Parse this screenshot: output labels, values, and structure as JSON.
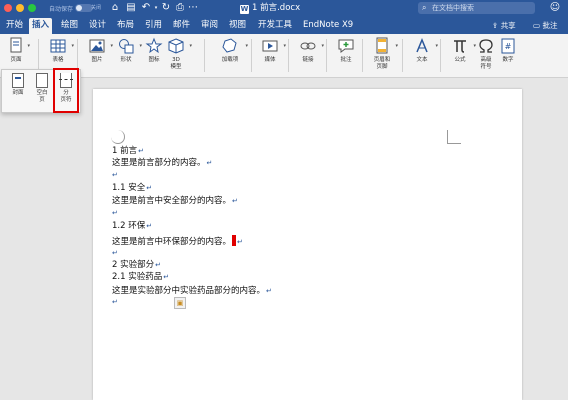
{
  "titlebar": {
    "autosave_label": "自动保存",
    "autosave_state": "关闭",
    "doc_title": "1 前言.docx",
    "search_placeholder": "在文档中搜索",
    "doc_icon": "W"
  },
  "tabs": [
    {
      "label": "开始"
    },
    {
      "label": "插入"
    },
    {
      "label": "绘图"
    },
    {
      "label": "设计"
    },
    {
      "label": "布局"
    },
    {
      "label": "引用"
    },
    {
      "label": "邮件"
    },
    {
      "label": "审阅"
    },
    {
      "label": "视图"
    },
    {
      "label": "开发工具"
    },
    {
      "label": "EndNote X9"
    }
  ],
  "tab_actions": {
    "share": "共享",
    "comments": "批注"
  },
  "ribbon": {
    "page": "页面",
    "table": "表格",
    "picture": "图片",
    "shapes": "形状",
    "icons": "图标",
    "model3d": "3D\n模型",
    "addins": "加载项",
    "media": "媒体",
    "link": "链接",
    "comment": "批注",
    "header_footer": "页眉和\n页脚",
    "text": "文本",
    "formula": "公式",
    "symbol": "高级\n符号",
    "number": "数字"
  },
  "popup": {
    "cover": "封面",
    "blank_page": "空白\n页",
    "page_break": "分\n页符"
  },
  "document": {
    "lines": [
      "1 前言",
      "这里是前言部分的内容。",
      "",
      "1.1 安全",
      "这里是前言中安全部分的内容。",
      "",
      "1.2 环保",
      "这里是前言中环保部分的内容。",
      "",
      "2  实验部分",
      "2.1  实验药品",
      "这里是实验部分中实验药品部分的内容。",
      ""
    ],
    "paragraph_mark": "↵"
  },
  "colors": {
    "accent": "#2b579a",
    "highlight": "#e00000"
  }
}
